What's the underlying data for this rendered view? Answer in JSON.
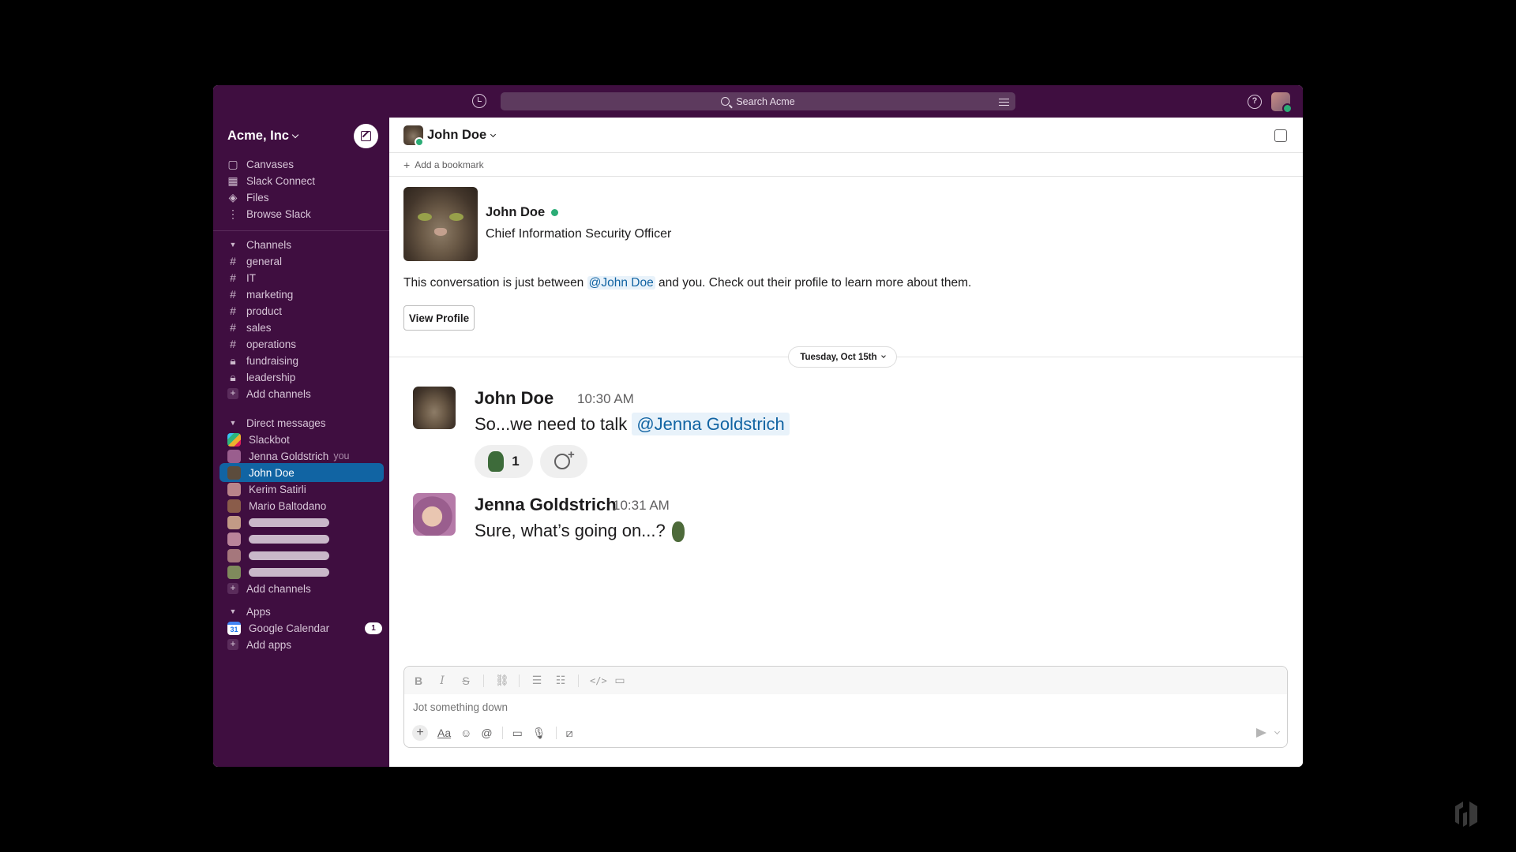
{
  "topbar": {
    "search_placeholder": "Search Acme"
  },
  "sidebar": {
    "workspace": "Acme, Inc",
    "nav": [
      {
        "label": "Canvases",
        "icon": "canvas-icon"
      },
      {
        "label": "Slack Connect",
        "icon": "building-icon"
      },
      {
        "label": "Files",
        "icon": "files-icon"
      },
      {
        "label": "Browse Slack",
        "icon": "more-vertical-icon"
      }
    ],
    "channels_header": "Channels",
    "channels": [
      {
        "label": "general",
        "icon": "hash-icon"
      },
      {
        "label": "IT",
        "icon": "hash-icon"
      },
      {
        "label": "marketing",
        "icon": "hash-icon"
      },
      {
        "label": "product",
        "icon": "hash-icon"
      },
      {
        "label": "sales",
        "icon": "hash-icon"
      },
      {
        "label": "operations",
        "icon": "hash-icon"
      },
      {
        "label": "fundraising",
        "icon": "lock-icon"
      },
      {
        "label": "leadership",
        "icon": "lock-icon"
      }
    ],
    "add_channels": "Add channels",
    "dm_header": "Direct messages",
    "dms": [
      {
        "label": "Slackbot",
        "color": "#e01e5a"
      },
      {
        "label": "Jenna Goldstrich",
        "you": "you",
        "color": "#9a5e8e"
      },
      {
        "label": "John Doe",
        "color": "#5c4c3c",
        "active": true
      },
      {
        "label": "Kerim Satirli",
        "color": "#b9848a"
      },
      {
        "label": "Mario Baltodano",
        "color": "#8a5c4a"
      }
    ],
    "add_dms": "Add channels",
    "apps_header": "Apps",
    "apps": [
      {
        "label": "Google Calendar",
        "badge": "1",
        "icon": "google-calendar-icon"
      }
    ],
    "add_apps": "Add apps"
  },
  "channel": {
    "name": "John Doe",
    "add_bookmark": "Add a bookmark"
  },
  "intro": {
    "name": "John Doe",
    "title": "Chief Information Security Officer",
    "text_before": "This conversation is just between ",
    "mention": "@John Doe",
    "text_after": " and you. Check out their profile to learn more about them.",
    "view_profile": "View Profile"
  },
  "date_divider": "Tuesday, Oct 15th",
  "messages": [
    {
      "author": "John Doe",
      "time": "10:30 AM",
      "text": "So...we need to talk ",
      "mention": "@Jenna Goldstrich",
      "reaction_count": "1"
    },
    {
      "author": "Jenna Goldstrich",
      "time": "10:31 AM",
      "text": "Sure, what’s going on...?"
    }
  ],
  "composer": {
    "placeholder": "Jot something down"
  },
  "colors": {
    "sidebar": "#3f0e40",
    "active_item": "#1164a3",
    "online": "#2bac76",
    "mention_text": "#1264a3"
  }
}
